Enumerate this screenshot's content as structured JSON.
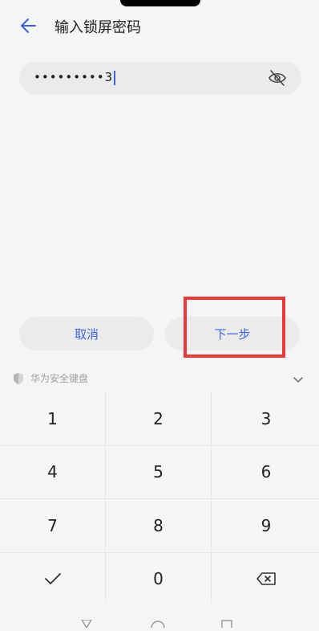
{
  "header": {
    "title": "输入锁屏密码",
    "back_icon": "arrow-left-icon"
  },
  "password": {
    "value": "•••••••••3",
    "visibility_icon": "eye-off-icon"
  },
  "buttons": {
    "cancel_label": "取消",
    "next_label": "下一步"
  },
  "keyboard": {
    "label": "华为安全键盘",
    "shield_icon": "shield-icon",
    "collapse_icon": "chevron-down-icon",
    "keys": [
      "1",
      "2",
      "3",
      "4",
      "5",
      "6",
      "7",
      "8",
      "9",
      "✓",
      "0",
      "⌫"
    ]
  },
  "colors": {
    "accent": "#3a63e0",
    "highlight": "#e83a3a",
    "background": "#f6f4f5"
  }
}
